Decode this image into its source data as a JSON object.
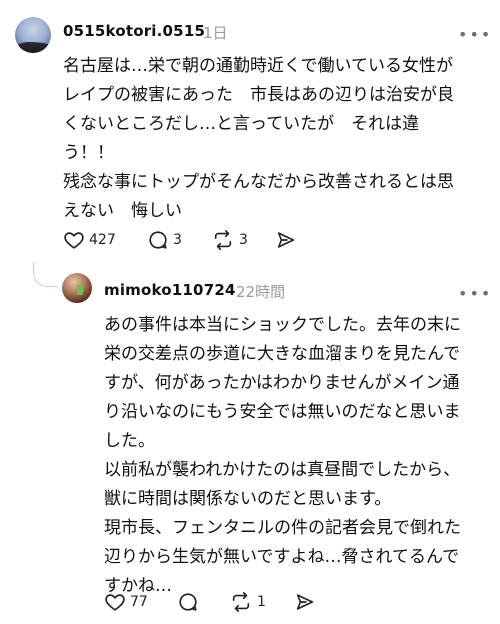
{
  "comment1": {
    "username": "0515kotori.0515",
    "time": "1日",
    "lines": [
      "名古屋は…栄で朝の通勤時近くで働いている女性が",
      "レイプの被害にあった　市長はあの辺りは治安が良",
      "くないところだし…と言っていたが　それは違",
      "う！！",
      "残念な事にトップがそんなだから改善されるとは思",
      "えない　悔しい"
    ],
    "likes": "427",
    "replies": "3",
    "reposts": "3"
  },
  "comment2": {
    "username": "mimoko110724",
    "time": "22時間",
    "lines": [
      "あの事件は本当にショックでした。去年の末に",
      "栄の交差点の歩道に大きな血溜まりを見たんで",
      "すが、何があったかはわかりませんがメイン通",
      "り沿いなのにもう安全では無いのだなと思いま",
      "した。",
      "以前私が襲われかけたのは真昼間でしたから、",
      "獣に時間は関係ないのだと思います。",
      "現市長、フェンタニルの件の記者会見で倒れた",
      "辺りから生気が無いですよね…脅されてるんで",
      "すかね…"
    ],
    "likes": "77",
    "replies": "",
    "reposts": "1"
  }
}
